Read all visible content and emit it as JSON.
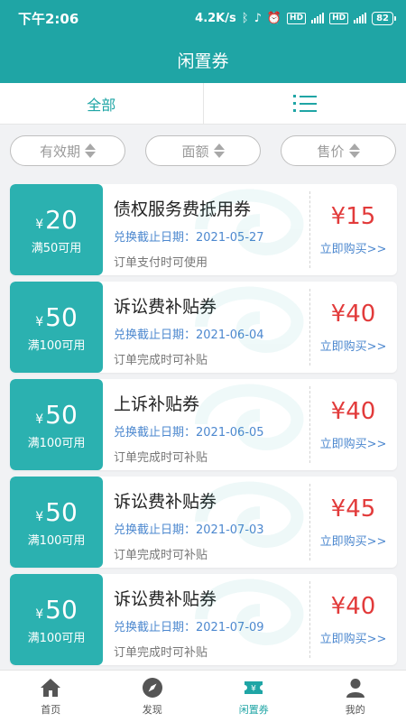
{
  "status_bar": {
    "time": "下午2:06",
    "network_speed": "4.2K/s",
    "hd1": "HD",
    "hd2": "HD",
    "battery": "82"
  },
  "header": {
    "title": "闲置券"
  },
  "tabs": {
    "all_label": "全部"
  },
  "filters": [
    {
      "label": "有效期"
    },
    {
      "label": "面额"
    },
    {
      "label": "售价"
    }
  ],
  "coupons": [
    {
      "currency": "¥",
      "amount": "20",
      "condition": "满50可用",
      "title": "债权服务费抵用券",
      "expiry": "兑换截止日期：2021-05-27",
      "note": "订单支付时可使用",
      "price": "¥15",
      "buy": "立即购买>>"
    },
    {
      "currency": "¥",
      "amount": "50",
      "condition": "满100可用",
      "title": "诉讼费补贴券",
      "expiry": "兑换截止日期：2021-06-04",
      "note": "订单完成时可补贴",
      "price": "¥40",
      "buy": "立即购买>>"
    },
    {
      "currency": "¥",
      "amount": "50",
      "condition": "满100可用",
      "title": "上诉补贴券",
      "expiry": "兑换截止日期：2021-06-05",
      "note": "订单完成时可补贴",
      "price": "¥40",
      "buy": "立即购买>>"
    },
    {
      "currency": "¥",
      "amount": "50",
      "condition": "满100可用",
      "title": "诉讼费补贴券",
      "expiry": "兑换截止日期：2021-07-03",
      "note": "订单完成时可补贴",
      "price": "¥45",
      "buy": "立即购买>>"
    },
    {
      "currency": "¥",
      "amount": "50",
      "condition": "满100可用",
      "title": "诉讼费补贴券",
      "expiry": "兑换截止日期：2021-07-09",
      "note": "订单完成时可补贴",
      "price": "¥40",
      "buy": "立即购买>>"
    }
  ],
  "bottom_nav": [
    {
      "label": "首页",
      "icon": "home-icon"
    },
    {
      "label": "发现",
      "icon": "compass-icon"
    },
    {
      "label": "闲置券",
      "icon": "ticket-icon",
      "active": true
    },
    {
      "label": "我的",
      "icon": "user-icon"
    }
  ],
  "colors": {
    "brand": "#1fa5a5",
    "coupon_left": "#2bb1b0",
    "price": "#e23b3b",
    "link": "#4d88cf"
  }
}
